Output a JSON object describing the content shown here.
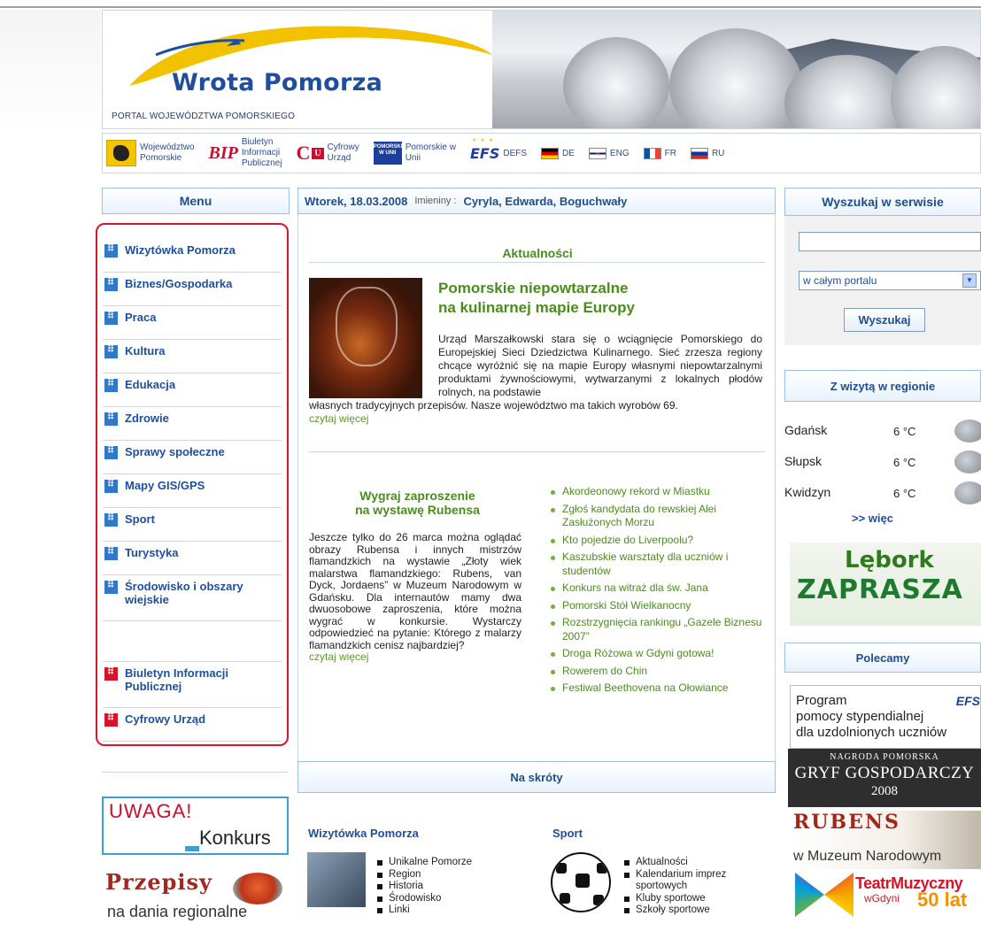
{
  "header": {
    "logo_word1": "Wrota",
    "logo_word2": "Pomorza",
    "subtitle": "PORTAL WOJEWÓDZTWA POMORSKIEGO"
  },
  "linkbar": {
    "woj_line1": "Województwo",
    "woj_line2": "Pomorskie",
    "bip_logo": "BIP",
    "bip_line1": "Biuletyn",
    "bip_line2": "Informacji",
    "bip_line3": "Publicznej",
    "cu_logo": "C",
    "cu_badge": "U",
    "cu_line1": "Cyfrowy",
    "cu_line2": "Urząd",
    "pw_badge": "POMORSKIE W UNII",
    "pw_line1": "Pomorskie w",
    "pw_line2": "Unii",
    "efs_logo": "EFS",
    "defs": "DEFS",
    "flags": [
      {
        "code": "DE",
        "colors": [
          "#000000",
          "#dd0000",
          "#ffce00"
        ]
      },
      {
        "code": "ENG",
        "colors": [
          "#012169",
          "#c8102e",
          "#ffffff"
        ]
      },
      {
        "code": "FR",
        "colors": [
          "#0055a4",
          "#ffffff",
          "#ef4135"
        ]
      },
      {
        "code": "RU",
        "colors": [
          "#ffffff",
          "#0039a6",
          "#d52b1e"
        ]
      }
    ]
  },
  "menu": {
    "title": "Menu",
    "items": [
      {
        "label": "Wizytówka Pomorza",
        "color": "blue"
      },
      {
        "label": "Biznes/Gospodarka",
        "color": "blue"
      },
      {
        "label": "Praca",
        "color": "blue"
      },
      {
        "label": "Kultura",
        "color": "blue"
      },
      {
        "label": "Edukacja",
        "color": "blue"
      },
      {
        "label": "Zdrowie",
        "color": "blue"
      },
      {
        "label": "Sprawy społeczne",
        "color": "blue"
      },
      {
        "label": "Mapy GIS/GPS",
        "color": "blue"
      },
      {
        "label": "Sport",
        "color": "blue"
      },
      {
        "label": "Turystyka",
        "color": "blue"
      },
      {
        "label": "Środowisko i obszary wiejskie",
        "color": "blue"
      },
      {
        "label": "Biuletyn Informacji Publicznej",
        "color": "red"
      },
      {
        "label": "Cyfrowy Urząd",
        "color": "red"
      }
    ]
  },
  "banners_left": {
    "uwaga": "UWAGA!",
    "konkurs": "Konkurs",
    "przepisy": "Przepisy",
    "przepisy_sub": "na dania regionalne"
  },
  "datebar": {
    "date": "Wtorek, 18.03.2008",
    "imieniny_label": "Imieniny :",
    "names": "Cyryla, Edwarda, Boguchwały"
  },
  "aktualnosci": {
    "title": "Aktualności",
    "main_title_line1": "Pomorskie niepowtarzalne",
    "main_title_line2": "na kulinarnej mapie Europy",
    "main_body": "Urząd Marszałkowski stara się o wciągnięcie Pomorskiego do Europejskiej Sieci Dziedzictwa Kulinarnego. Sieć zrzesza regiony chcące wyróżnić się na mapie Europy własnymi niepowtarzalnymi produktami żywnościowymi, wytwarzanymi z lokalnych płodów rolnych, na podstawie",
    "main_body_tail": "własnych tradycyjnych przepisów. Nasze województwo ma takich wyrobów 69.",
    "read_more": "czytaj więcej",
    "rubens_title_line1": "Wygraj zaproszenie",
    "rubens_title_line2": "na wystawę Rubensa",
    "rubens_body": "Jeszcze tylko do 26 marca można oglądać obrazy Rubensa i innych mistrzów flamandzkich na wystawie „Złoty wiek malarstwa flamandzkiego: Rubens, van Dyck, Jordaens” w Muzeum Narodowym w Gdańsku. Dla internautów mamy dwa dwuosobowe zaproszenia, które można wygrać w konkursie. Wystarczy odpowiedzieć na pytanie: Którego z malarzy flamandzkich cenisz najbardziej?",
    "read_more2": "czytaj więcej",
    "news": [
      "Akordeonowy rekord w Miastku",
      "Zgłoś kandydata do rewskiej Alei Zasłużonych Morzu",
      "Kto pojedzie do Liverpoolu?",
      "Kaszubskie warsztaty dla uczniów i studentów",
      "Konkurs na witraż dla św. Jana",
      "Pomorski Stół Wielkanocny",
      "Rozstrzygnięcia rankingu „Gazele Biznesu 2007”",
      "Droga Różowa w Gdyni gotowa!",
      "Rowerem do Chin",
      "Festiwal Beethovena na Ołowiance"
    ]
  },
  "skroty": {
    "title": "Na skróty",
    "col1_title": "Wizytówka Pomorza",
    "col1_items": [
      "Unikalne Pomorze",
      "Region",
      "Historia",
      "Środowisko",
      "Linki"
    ],
    "col2_title": "Sport",
    "col2_items": [
      "Aktualności",
      "Kalendarium imprez sportowych",
      "Kluby sportowe",
      "Szkoły sportowe"
    ]
  },
  "search": {
    "title": "Wyszukaj w serwisie",
    "input_value": "",
    "scope": "w całym portalu",
    "button": "Wyszukaj"
  },
  "wizyta": {
    "title": "Z wizytą w regionie",
    "cities": [
      {
        "city": "Gdańsk",
        "temp": "6 °C"
      },
      {
        "city": "Słupsk",
        "temp": "6 °C"
      },
      {
        "city": "Kwidzyn",
        "temp": "6 °C"
      }
    ],
    "more": ">> więc"
  },
  "lebork": {
    "line1": "Lębork",
    "line2": "ZAPRASZA"
  },
  "polecamy": {
    "title": "Polecamy",
    "program_line1": "Program",
    "program_line2": "pomocy stypendialnej",
    "program_line3": "dla uzdolnionych uczniów",
    "efs": "EFS",
    "gryf_line1": "NAGRODA POMORSKA",
    "gryf_line2": "GRYF GOSPODARCZY",
    "gryf_line3": "2008",
    "rubens_word": "RUBENS",
    "rubens_sub": "w Muzeum Narodowym",
    "teatr_line1": "TeatrMuzyczny",
    "teatr_line2": "wGdyni",
    "teatr_line3": "50 lat"
  }
}
